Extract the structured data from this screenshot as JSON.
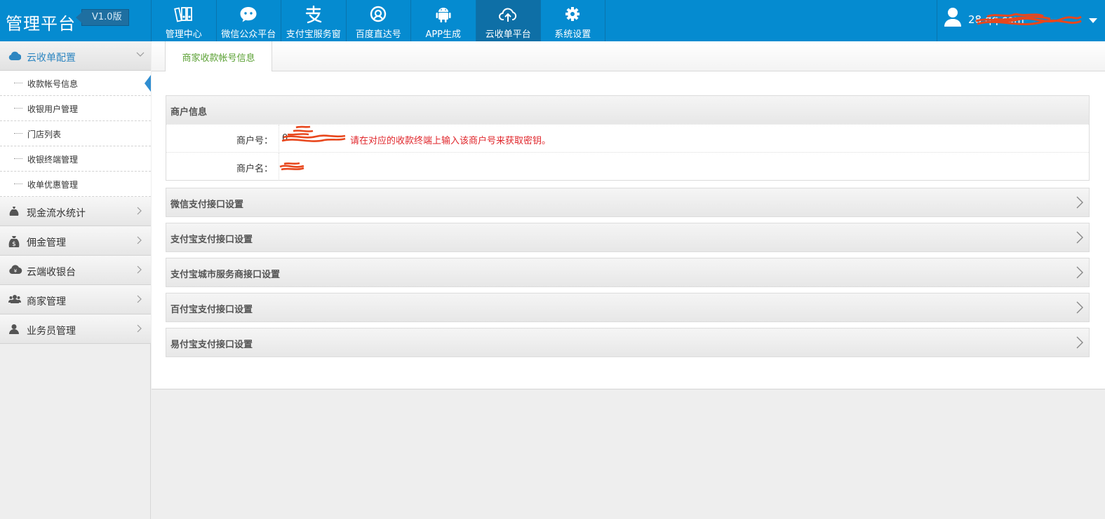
{
  "header": {
    "brand": "管理平台",
    "version": "V1.0版",
    "nav": [
      {
        "label": "管理中心",
        "icon": "binders-icon"
      },
      {
        "label": "微信公众平台",
        "icon": "wechat-icon"
      },
      {
        "label": "支付宝服务窗",
        "icon": "alipay-icon"
      },
      {
        "label": "百度直达号",
        "icon": "baidu-icon"
      },
      {
        "label": "APP生成",
        "icon": "android-icon"
      },
      {
        "label": "云收单平台",
        "icon": "cloud-upload-icon",
        "active": true
      },
      {
        "label": "系统设置",
        "icon": "gear-icon"
      }
    ],
    "user": {
      "name_visible": "28              qq.com",
      "icon": "user-icon"
    }
  },
  "sidebar": {
    "groups": [
      {
        "label": "云收单配置",
        "icon": "cloud-icon",
        "expanded": true
      },
      {
        "label": "现金流水统计",
        "icon": "money-bag-icon"
      },
      {
        "label": "佣金管理",
        "icon": "dollar-bag-icon"
      },
      {
        "label": "云端收银台",
        "icon": "cloud-yen-icon"
      },
      {
        "label": "商家管理",
        "icon": "users-icon"
      },
      {
        "label": "业务员管理",
        "icon": "user-icon"
      }
    ],
    "subitems": [
      {
        "label": "收款帐号信息",
        "active": true
      },
      {
        "label": "收银用户管理"
      },
      {
        "label": "门店列表"
      },
      {
        "label": "收银终端管理"
      },
      {
        "label": "收单优惠管理"
      }
    ]
  },
  "main": {
    "tab": "商家收款帐号信息",
    "merchant_info": {
      "title": "商户信息",
      "rows": [
        {
          "label": "商户号：",
          "value": "0",
          "hint": "请在对应的收款终端上输入该商户号来获取密钥。"
        },
        {
          "label": "商户名：",
          "value": ""
        }
      ]
    },
    "sections": [
      "微信支付接口设置",
      "支付宝支付接口设置",
      "支付宝城市服务商接口设置",
      "百付宝支付接口设置",
      "易付宝支付接口设置"
    ]
  },
  "colors": {
    "header_bg": "#058bd0",
    "nav_active_bg": "#0e6fa6",
    "accent_blue": "#2e86c1",
    "tab_text_green": "#5aa033",
    "hint_red": "#e0262b",
    "redaction": "#e8471d"
  }
}
